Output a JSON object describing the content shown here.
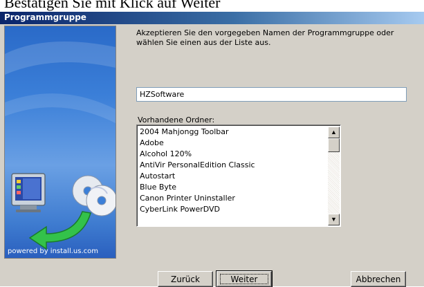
{
  "caption": "Bestätigen Sie mit Klick auf Weiter",
  "window": {
    "title": "Programmgruppe"
  },
  "side_panel": {
    "powered_by": "powered by install.us.com"
  },
  "instruction": "Akzeptieren Sie den vorgegeben Namen der Programmgruppe oder wählen Sie einen aus der Liste aus.",
  "group_name": {
    "value": "HZSoftware"
  },
  "folders": {
    "label": "Vorhandene Ordner:",
    "items": [
      "2004 Mahjongg Toolbar",
      "Adobe",
      "Alcohol 120%",
      "AntiVir PersonalEdition Classic",
      "Autostart",
      "Blue Byte",
      "Canon Printer Uninstaller",
      "CyberLink PowerDVD"
    ]
  },
  "buttons": {
    "back": "Zurück",
    "next": "Weiter",
    "cancel": "Abbrechen"
  },
  "colors": {
    "dialog_face": "#d4d0c8",
    "title_gradient_start": "#0a246a",
    "title_gradient_end": "#a6caf0",
    "side_panel_blue": "#3b7fd8"
  },
  "icons": [
    "computer-monitor-icon",
    "cd-disc-icon",
    "green-arrow-icon",
    "scroll-up-arrow-icon",
    "scroll-down-arrow-icon"
  ]
}
